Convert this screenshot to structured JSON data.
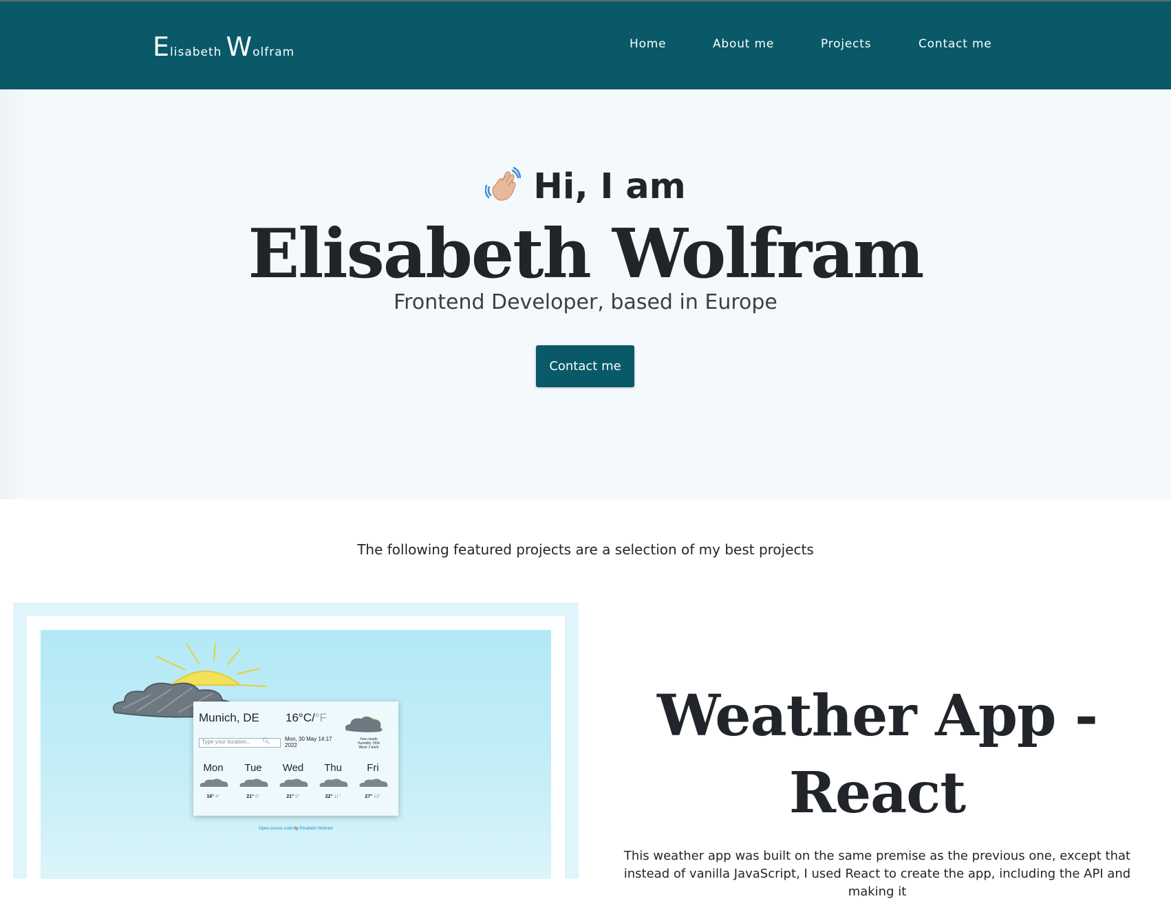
{
  "navbar": {
    "brand_first_initial": "E",
    "brand_first_rest": "lisabeth",
    "brand_last_initial": "W",
    "brand_last_rest": "olfram",
    "links": [
      "Home",
      "About me",
      "Projects",
      "Contact me"
    ],
    "background": "#095968"
  },
  "hero": {
    "greeting": "Hi, I am",
    "wave_icon": "waving-hand-icon",
    "name": "Elisabeth Wolfram",
    "subtitle": "Frontend Developer, based in Europe",
    "button_label": "Contact me"
  },
  "projects": {
    "intro": "The following featured projects are a selection of my best projects",
    "featured": {
      "title_line1": "Weather App -",
      "title_line2": "React",
      "description": "This weather app was built on the same premise as the previous one, except that instead of vanilla JavaScript, I used React to create the app, including the API and making it",
      "screenshot": {
        "city": "Munich, DE",
        "temp_c": "16°C",
        "temp_sep": "/",
        "temp_f": "°F",
        "search_placeholder": "Type your location...",
        "date_line1": "Mon, 30 May 14:17",
        "date_line2": "2022",
        "desc_line1": "Few clouds",
        "desc_line2": "Humidity: 55%",
        "desc_line3": "Wind: 2 km/h",
        "forecast": [
          {
            "day": "Mon",
            "high": "16°",
            "low": "4°"
          },
          {
            "day": "Tue",
            "high": "21°",
            "low": "6°"
          },
          {
            "day": "Wed",
            "high": "21°",
            "low": "9°"
          },
          {
            "day": "Thu",
            "high": "22°",
            "low": "11°"
          },
          {
            "day": "Fri",
            "high": "27°",
            "low": "13°"
          }
        ],
        "footer_link": "Open-source code",
        "footer_by": "by",
        "footer_author": "Elisabeth Wolfram"
      }
    }
  }
}
